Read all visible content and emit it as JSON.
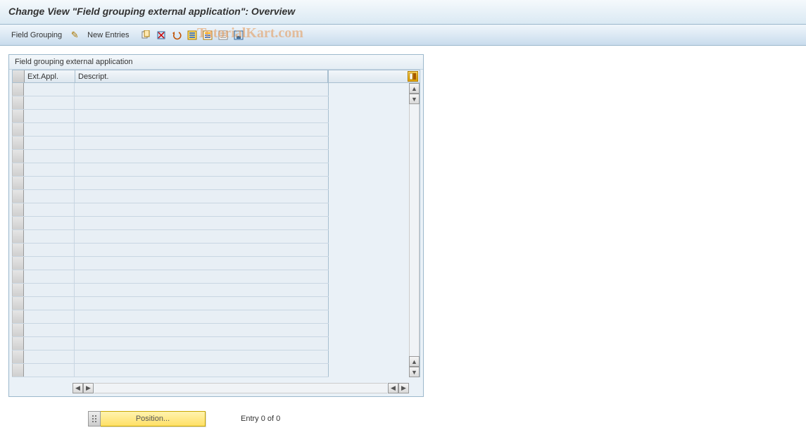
{
  "title": "Change View \"Field grouping external application\": Overview",
  "toolbar": {
    "field_grouping_label": "Field Grouping",
    "new_entries_label": "New Entries",
    "icons": [
      "copy",
      "delete",
      "undo",
      "select-all",
      "select-block",
      "deselect-all",
      "print"
    ]
  },
  "watermark": "TutorialKart.com",
  "panel": {
    "title": "Field grouping external application",
    "columns": {
      "ext_appl": "Ext.Appl.",
      "descript": "Descript."
    },
    "rows_count": 22
  },
  "footer": {
    "position_label": "Position...",
    "entry_text": "Entry 0 of 0"
  }
}
